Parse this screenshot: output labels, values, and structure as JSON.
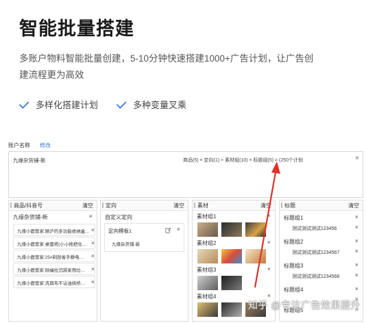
{
  "hero": {
    "title": "智能批量搭建",
    "desc_line1": "多账户物料智能批量创建，5-10分钟快速搭建1000+广告计划，让广告创",
    "desc_line2": "建流程更为高效",
    "feature1": "多样化搭建计划",
    "feature2": "多种变量叉乘"
  },
  "account": {
    "label": "账户名称",
    "edit": "修改",
    "name": "九缘杂货铺-新",
    "formula": "商品(5) × 定向(1) × 素材组(10) × 标题组(5) = (250个计划"
  },
  "columns": {
    "products": {
      "title": "商品/抖音号",
      "clear": "清空",
      "group": "九缘杂货铺-新",
      "items": [
        "九缘小鹿管家:随沪的多功能收纳盒…",
        "九缘小鹿管家:桌面塔(小小拖把化…",
        "九缘小鹿管家:25#剃刮省手静电…",
        "九缘小鹿管家:除蛹拉沉袋家用垃…",
        "九缘小鹿管家:洗扇布不沾油抹桥…"
      ]
    },
    "targeting": {
      "title": "定向",
      "clear": "清空",
      "custom": "自定义定向",
      "template": "定向模板1",
      "template_acct": "九缘杂货铺-新"
    },
    "material": {
      "title": "素材",
      "clear": "清空",
      "groups": [
        "素材组1",
        "素材组2",
        "素材组3",
        "素材组4"
      ]
    },
    "titles": {
      "title": "标题",
      "clear": "清空",
      "groups": [
        {
          "name": "标题组1",
          "text": "测试测试测试123456"
        },
        {
          "name": "标题组2",
          "text": "测试测试测试1234567"
        },
        {
          "name": "标题组3",
          "text": "测试测试测试1234568"
        },
        {
          "name": "标题组4",
          "text": ""
        },
        {
          "name": "标题组5",
          "text": ""
        }
      ]
    }
  },
  "watermark": "知乎 @专注广告效果提升",
  "icons": {
    "check": "check-icon",
    "close": "close-icon",
    "edit": "edit-icon",
    "arrow": "red-arrow"
  },
  "colors": {
    "accent": "#4a86d8",
    "link": "#3a7bd5",
    "arrow": "#e0302a"
  }
}
